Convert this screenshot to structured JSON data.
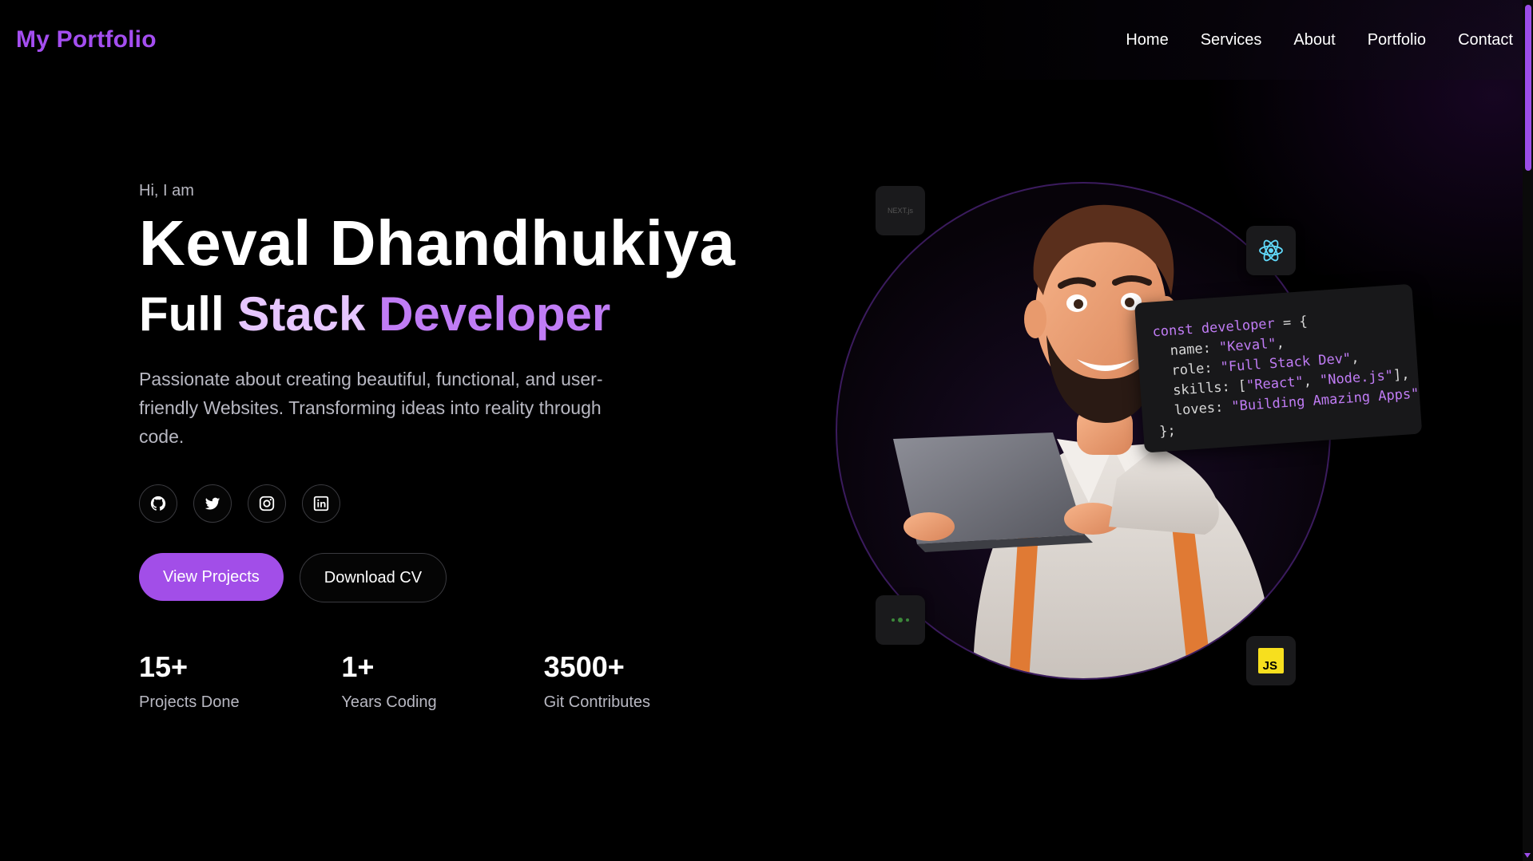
{
  "header": {
    "logo": "My Portfolio",
    "nav": [
      {
        "label": "Home"
      },
      {
        "label": "Services"
      },
      {
        "label": "About"
      },
      {
        "label": "Portfolio"
      },
      {
        "label": "Contact"
      }
    ]
  },
  "hero": {
    "greeting": "Hi, I am",
    "name": "Keval Dhandhukiya",
    "role_words": [
      "Full",
      "Stack",
      "Developer"
    ],
    "description": "Passionate about creating beautiful, functional, and user-friendly Websites. Transforming ideas into reality through code.",
    "socials": [
      {
        "icon": "github-icon"
      },
      {
        "icon": "twitter-icon"
      },
      {
        "icon": "instagram-icon"
      },
      {
        "icon": "linkedin-icon"
      }
    ],
    "primary_button": "View Projects",
    "secondary_button": "Download CV",
    "stats": [
      {
        "value": "15+",
        "label": "Projects Done"
      },
      {
        "value": "1+",
        "label": "Years Coding"
      },
      {
        "value": "3500+",
        "label": "Git Contributes"
      }
    ]
  },
  "visual": {
    "badges": [
      {
        "icon": "nextjs-icon",
        "label": "NEXT.js"
      },
      {
        "icon": "react-icon"
      },
      {
        "icon": "nodejs-icon"
      },
      {
        "icon": "javascript-icon",
        "label": "JS"
      }
    ],
    "code": {
      "line1_kw": "const developer",
      "line1_rest": " = {",
      "name_key": "  name: ",
      "name_val": "\"Keval\"",
      "role_key": "  role: ",
      "role_val": "\"Full Stack Dev\"",
      "skills_key": "  skills: [",
      "skills_v1": "\"React\"",
      "skills_sep": ", ",
      "skills_v2": "\"Node.js\"",
      "skills_end": "],",
      "loves_key": "  loves: ",
      "loves_val": "\"Building Amazing Apps\"",
      "close": "};"
    }
  },
  "colors": {
    "accent": "#a24ee8",
    "background": "#000000"
  }
}
